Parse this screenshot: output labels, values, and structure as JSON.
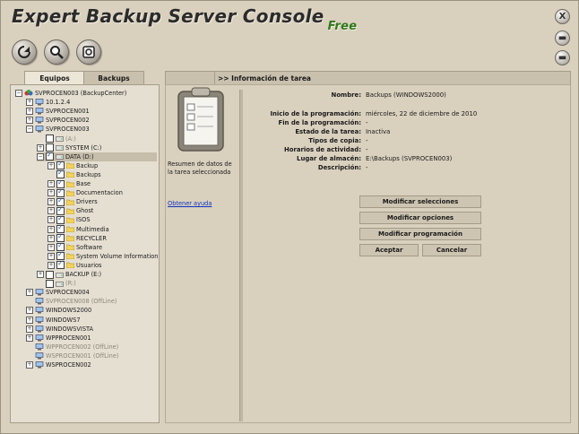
{
  "app": {
    "title": "Expert Backup Server Console",
    "edition": "Free"
  },
  "toolbar": {
    "icons": [
      "refresh-icon",
      "search-icon",
      "settings-icon"
    ]
  },
  "window_buttons": {
    "close": "X",
    "maximize": "▬",
    "minimize": "▬"
  },
  "left_tabs": [
    "Equipos",
    "Backups"
  ],
  "tree": [
    {
      "label": "SVPROCEN003 (BackupCenter)",
      "level": 0,
      "exp": "-",
      "type": "root"
    },
    {
      "label": "10.1.2.4",
      "level": 1,
      "exp": "+",
      "type": "computer"
    },
    {
      "label": "SVPROCEN001",
      "level": 1,
      "exp": "+",
      "type": "computer"
    },
    {
      "label": "SVPROCEN002",
      "level": 1,
      "exp": "+",
      "type": "computer"
    },
    {
      "label": "SVPROCEN003",
      "level": 1,
      "exp": "-",
      "type": "computer"
    },
    {
      "label": "(A:)",
      "level": 2,
      "exp": "",
      "type": "drive",
      "dim": true,
      "chk": false
    },
    {
      "label": "SYSTEM (C:)",
      "level": 2,
      "exp": "+",
      "type": "drive",
      "chk": false
    },
    {
      "label": "DATA (D:)",
      "level": 2,
      "exp": "-",
      "type": "drive",
      "chk": true,
      "sel": true
    },
    {
      "label": "Backup",
      "level": 3,
      "exp": "+",
      "type": "folder",
      "chk": true
    },
    {
      "label": "Backups",
      "level": 3,
      "exp": "",
      "type": "folder",
      "chk": true
    },
    {
      "label": "Base",
      "level": 3,
      "exp": "+",
      "type": "folder",
      "chk": true
    },
    {
      "label": "Documentacion",
      "level": 3,
      "exp": "+",
      "type": "folder",
      "chk": true
    },
    {
      "label": "Drivers",
      "level": 3,
      "exp": "+",
      "type": "folder",
      "chk": true
    },
    {
      "label": "Ghost",
      "level": 3,
      "exp": "+",
      "type": "folder",
      "chk": true
    },
    {
      "label": "ISOS",
      "level": 3,
      "exp": "+",
      "type": "folder",
      "chk": true
    },
    {
      "label": "Multimedia",
      "level": 3,
      "exp": "+",
      "type": "folder",
      "chk": true
    },
    {
      "label": "RECYCLER",
      "level": 3,
      "exp": "+",
      "type": "folder",
      "chk": true
    },
    {
      "label": "Software",
      "level": 3,
      "exp": "+",
      "type": "folder",
      "chk": true
    },
    {
      "label": "System Volume Information",
      "level": 3,
      "exp": "+",
      "type": "folder",
      "chk": true
    },
    {
      "label": "Usuarios",
      "level": 3,
      "exp": "+",
      "type": "folder",
      "chk": true
    },
    {
      "label": "BACKUP (E:)",
      "level": 2,
      "exp": "+",
      "type": "drive",
      "chk": false
    },
    {
      "label": "(R:)",
      "level": 2,
      "exp": "",
      "type": "drive",
      "dim": true,
      "chk": false
    },
    {
      "label": "SVPROCEN004",
      "level": 1,
      "exp": "+",
      "type": "computer"
    },
    {
      "label": "SVPROCEN008 (OffLine)",
      "level": 1,
      "exp": "",
      "type": "computer",
      "dim": true
    },
    {
      "label": "WINDOWS2000",
      "level": 1,
      "exp": "+",
      "type": "computer"
    },
    {
      "label": "WINDOWS7",
      "level": 1,
      "exp": "+",
      "type": "computer"
    },
    {
      "label": "WINDOWSVISTA",
      "level": 1,
      "exp": "+",
      "type": "computer"
    },
    {
      "label": "WPPROCEN001",
      "level": 1,
      "exp": "+",
      "type": "computer"
    },
    {
      "label": "WPPROCEN002 (OffLine)",
      "level": 1,
      "exp": "",
      "type": "computer",
      "dim": true
    },
    {
      "label": "WSPROCEN001 (OffLine)",
      "level": 1,
      "exp": "",
      "type": "computer",
      "dim": true
    },
    {
      "label": "WSPROCEN002",
      "level": 1,
      "exp": "+",
      "type": "computer"
    }
  ],
  "right_header": ">> Información de tarea",
  "task_summary": "Resumen de datos de la tarea seleccionada",
  "help_link": "Obtener ayuda",
  "task_info": [
    {
      "label": "Nombre:",
      "value": "Backups (WINDOWS2000)"
    },
    {
      "label": "Inicio de la programación:",
      "value": "miércoles, 22 de diciembre de 2010"
    },
    {
      "label": "Fin de la programación:",
      "value": "-"
    },
    {
      "label": "Estado de la tarea:",
      "value": "Inactiva"
    },
    {
      "label": "Tipos de copia:",
      "value": "-"
    },
    {
      "label": "Horarios de actividad:",
      "value": "-"
    },
    {
      "label": "Lugar de almacén:",
      "value": "E:\\Backups (SVPROCEN003)"
    },
    {
      "label": "Descripción:",
      "value": "-"
    }
  ],
  "buttons": {
    "modify_selections": "Modificar selecciones",
    "modify_options": "Modificar opciones",
    "modify_schedule": "Modificar programación",
    "accept": "Aceptar",
    "cancel": "Cancelar"
  }
}
